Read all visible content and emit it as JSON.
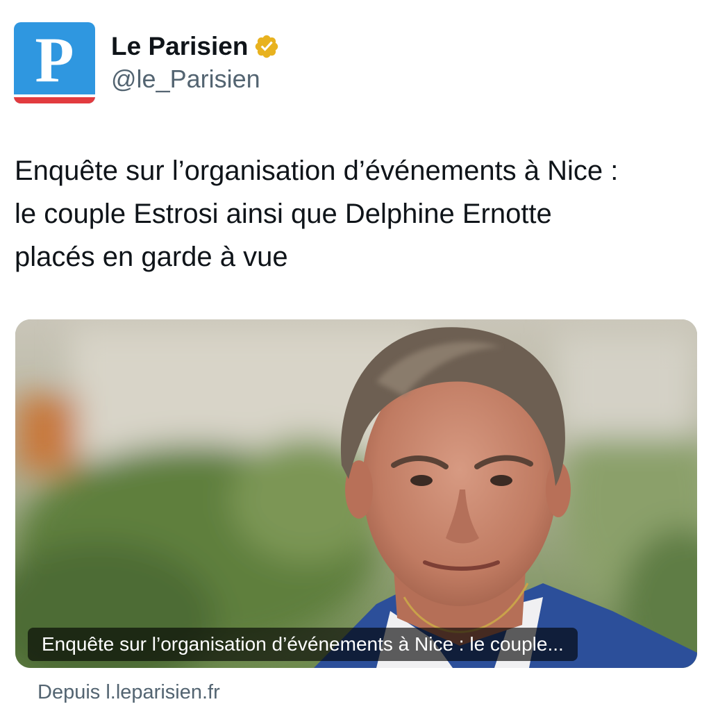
{
  "account": {
    "display_name": "Le Parisien",
    "handle": "@le_Parisien",
    "avatar_letter": "P",
    "avatar_color": "#2f97e0",
    "avatar_stripe_color": "#e23b3f",
    "verified_badge_color": "#e8b21f",
    "verified_icon": "verified-badge-icon"
  },
  "tweet": {
    "lines": [
      "Enquête sur l’organisation d’événements à Nice :",
      "le couple Estrosi ainsi que Delphine Ernotte",
      "placés en garde à vue"
    ]
  },
  "card": {
    "caption": "Enquête sur l’organisation d’événements à Nice : le couple...",
    "source": "Depuis l.leparisien.fr"
  }
}
